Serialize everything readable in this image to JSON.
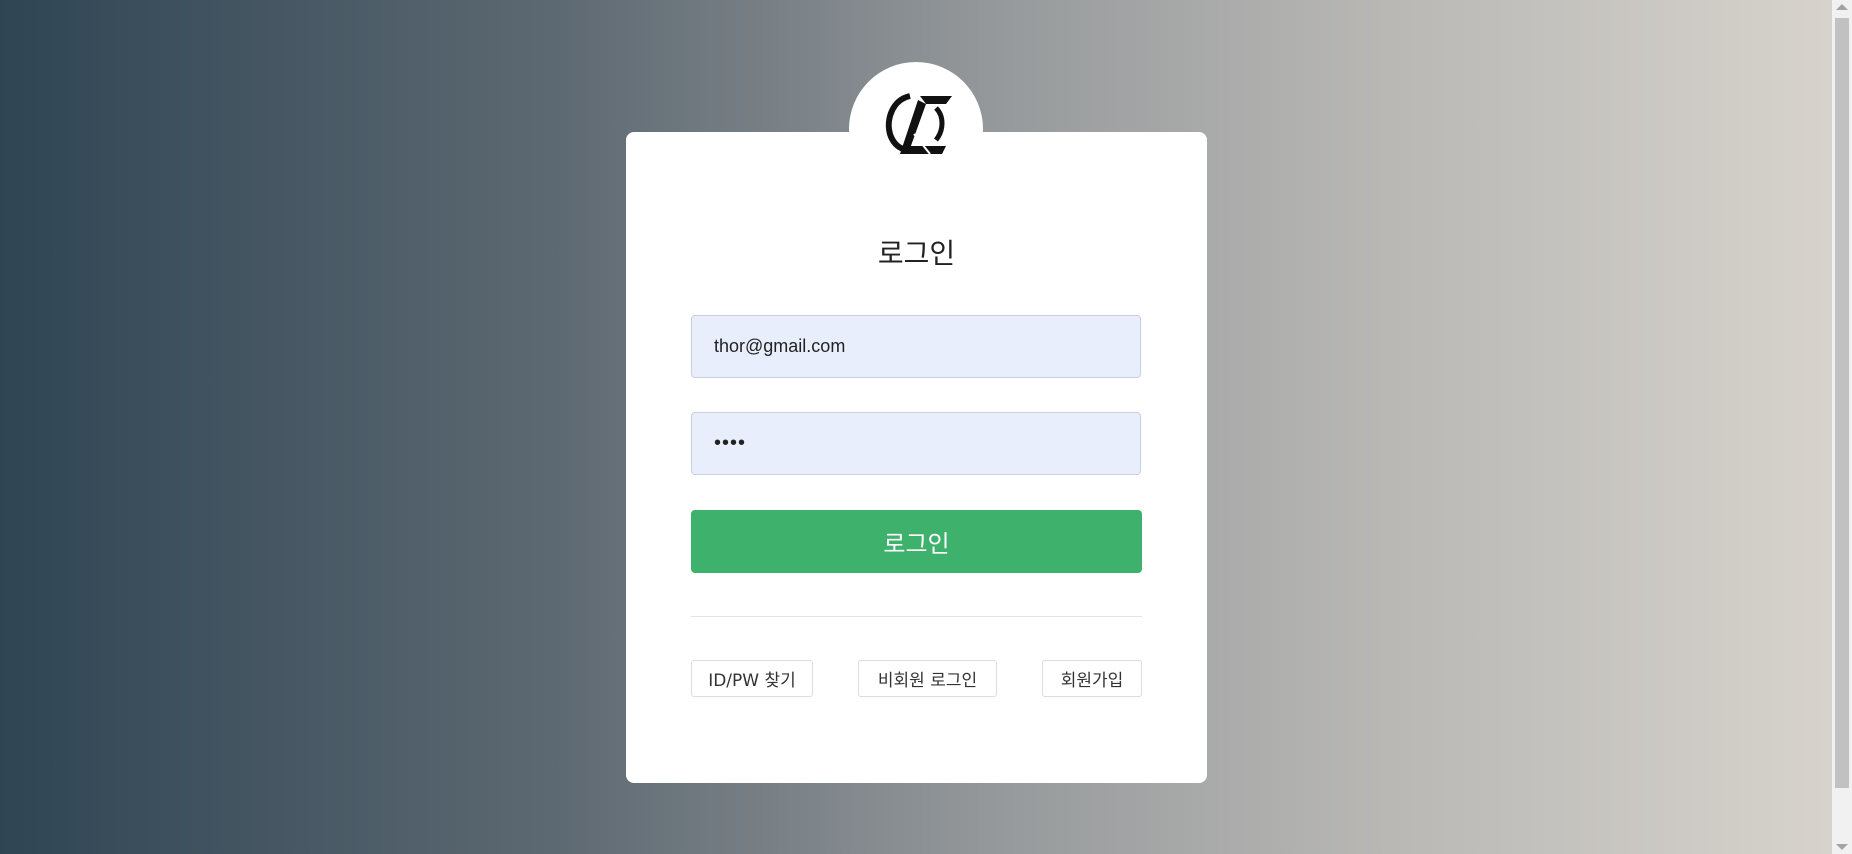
{
  "login": {
    "title": "로그인",
    "email_value": "thor@gmail.com",
    "password_value": "••••",
    "submit_label": "로그인"
  },
  "links": {
    "find_id_pw": "ID/PW 찾기",
    "guest_login": "비회원 로그인",
    "signup": "회원가입"
  },
  "logo": {
    "icon": "brand-logo-icon"
  },
  "colors": {
    "primary_button": "#3eb16d",
    "input_background": "#e8eefc",
    "card_background": "#ffffff"
  }
}
